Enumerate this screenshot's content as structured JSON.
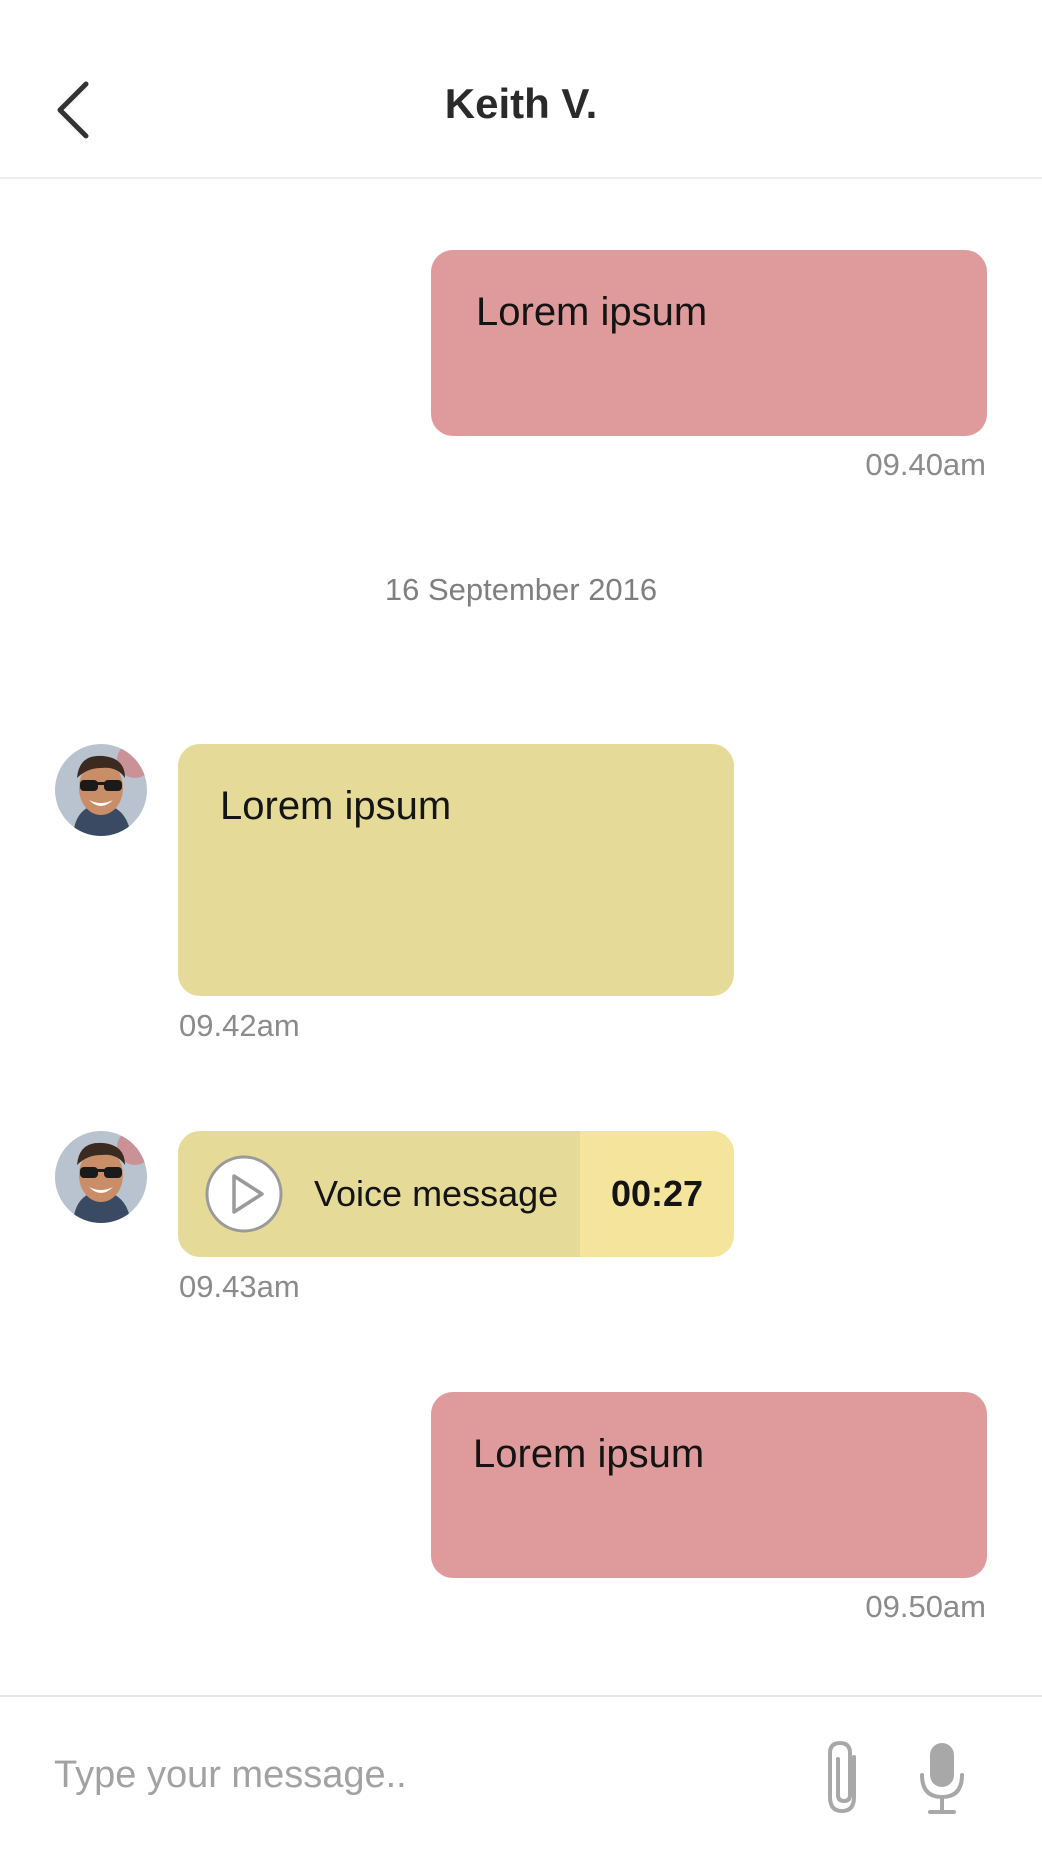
{
  "header": {
    "title": "Keith V.",
    "back_icon": "chevron-left-icon"
  },
  "messages": [
    {
      "direction": "outgoing",
      "text": "Lorem ipsum",
      "time": "09.40am"
    },
    {
      "direction": "incoming",
      "text": "Lorem ipsum",
      "time": "09.42am"
    },
    {
      "direction": "incoming",
      "type": "voice",
      "label": "Voice message",
      "duration": "00:27",
      "time": "09.43am"
    },
    {
      "direction": "outgoing",
      "text": "Lorem ipsum",
      "time": "09.50am"
    }
  ],
  "date_separator": "16 September 2016",
  "composer": {
    "placeholder": "Type your message..",
    "attach_icon": "paperclip-icon",
    "mic_icon": "microphone-icon"
  },
  "colors": {
    "outgoing_bubble": "#df9b9c",
    "incoming_bubble": "#e5da97",
    "voice_duration_bg": "#f4e49c",
    "timestamp": "#8b8b8b"
  }
}
